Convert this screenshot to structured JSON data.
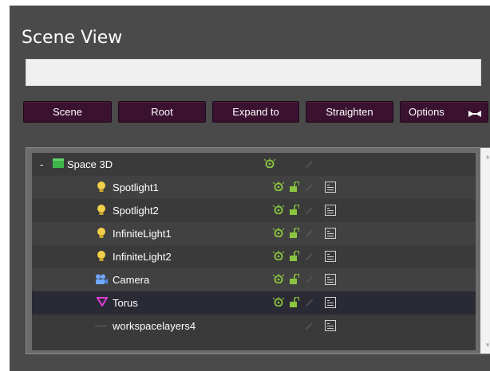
{
  "panel": {
    "title": "Scene View"
  },
  "search": {
    "value": "",
    "placeholder": ""
  },
  "toolbar": {
    "scene_label": "Scene",
    "root_label": "Root",
    "expand_label": "Expand to",
    "straighten_label": "Straighten",
    "options_label": "Options"
  },
  "tree": {
    "rows": [
      {
        "label": "Space 3D",
        "icon": "folder-icon",
        "level": 0,
        "expanded": true,
        "visible": true,
        "locked": null,
        "editable": true,
        "layer": false,
        "selected": false
      },
      {
        "label": "Spotlight1",
        "icon": "light-bulb-icon",
        "level": 1,
        "visible": true,
        "locked": false,
        "editable": true,
        "layer": true,
        "selected": false
      },
      {
        "label": "Spotlight2",
        "icon": "light-bulb-icon",
        "level": 1,
        "visible": true,
        "locked": false,
        "editable": true,
        "layer": true,
        "selected": false
      },
      {
        "label": "InfiniteLight1",
        "icon": "light-bulb-icon",
        "level": 1,
        "visible": true,
        "locked": false,
        "editable": true,
        "layer": true,
        "selected": false
      },
      {
        "label": "InfiniteLight2",
        "icon": "light-bulb-icon",
        "level": 1,
        "visible": true,
        "locked": false,
        "editable": true,
        "layer": true,
        "selected": false
      },
      {
        "label": "Camera",
        "icon": "camera-icon",
        "level": 1,
        "visible": true,
        "locked": false,
        "editable": true,
        "layer": true,
        "selected": false
      },
      {
        "label": "Torus",
        "icon": "torus-icon",
        "level": 1,
        "visible": true,
        "locked": false,
        "editable": true,
        "layer": true,
        "selected": true
      },
      {
        "label": "workspacelayers4",
        "icon": "dash-icon",
        "level": 1,
        "visible": false,
        "locked": null,
        "editable": true,
        "layer": true,
        "selected": false
      }
    ]
  },
  "colors": {
    "panel_bg": "#4a4a4a",
    "button_bg": "#3a1230",
    "visible_icon": "#8bc53f",
    "folder_icon": "#3cb54a",
    "bulb_icon": "#f2d04a",
    "camera_icon": "#6fa8ff",
    "torus_icon": "#e03cdc"
  }
}
